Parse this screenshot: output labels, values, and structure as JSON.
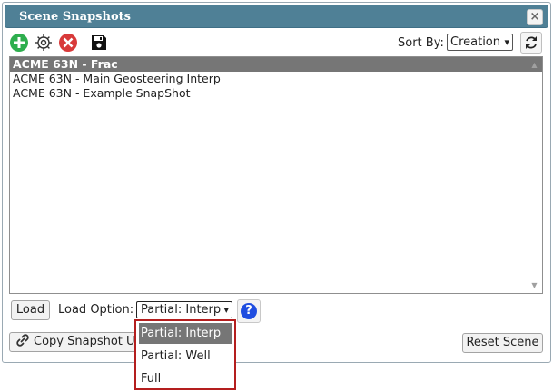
{
  "window": {
    "title": "Scene Snapshots",
    "close_glyph": "×"
  },
  "toolbar": {
    "icons": [
      "add-icon",
      "gear-icon",
      "delete-icon",
      "save-icon"
    ],
    "sort_label": "Sort By:",
    "sort_value": "Creation",
    "refresh_icon": "refresh-icon"
  },
  "snapshots": {
    "items": [
      {
        "label": "ACME 63N - Frac",
        "selected": true
      },
      {
        "label": "ACME 63N - Main Geosteering Interp",
        "selected": false
      },
      {
        "label": "ACME 63N - Example SnapShot",
        "selected": false
      }
    ]
  },
  "footer": {
    "load_label": "Load",
    "load_option_label": "Load Option:",
    "load_option_value": "Partial: Interp",
    "help_glyph": "?",
    "copy_label": "Copy Snapshot URL",
    "reset_label": "Reset Scene"
  },
  "dropdown": {
    "options": [
      "Partial: Interp",
      "Partial: Well",
      "Full"
    ],
    "selected": "Partial: Interp"
  },
  "colors": {
    "titlebar": "#4f8096",
    "selected_row": "#767676",
    "dropdown_border": "#b41e1e",
    "add": "#2eae4e",
    "delete": "#d83a3a",
    "help": "#1f4de0"
  }
}
